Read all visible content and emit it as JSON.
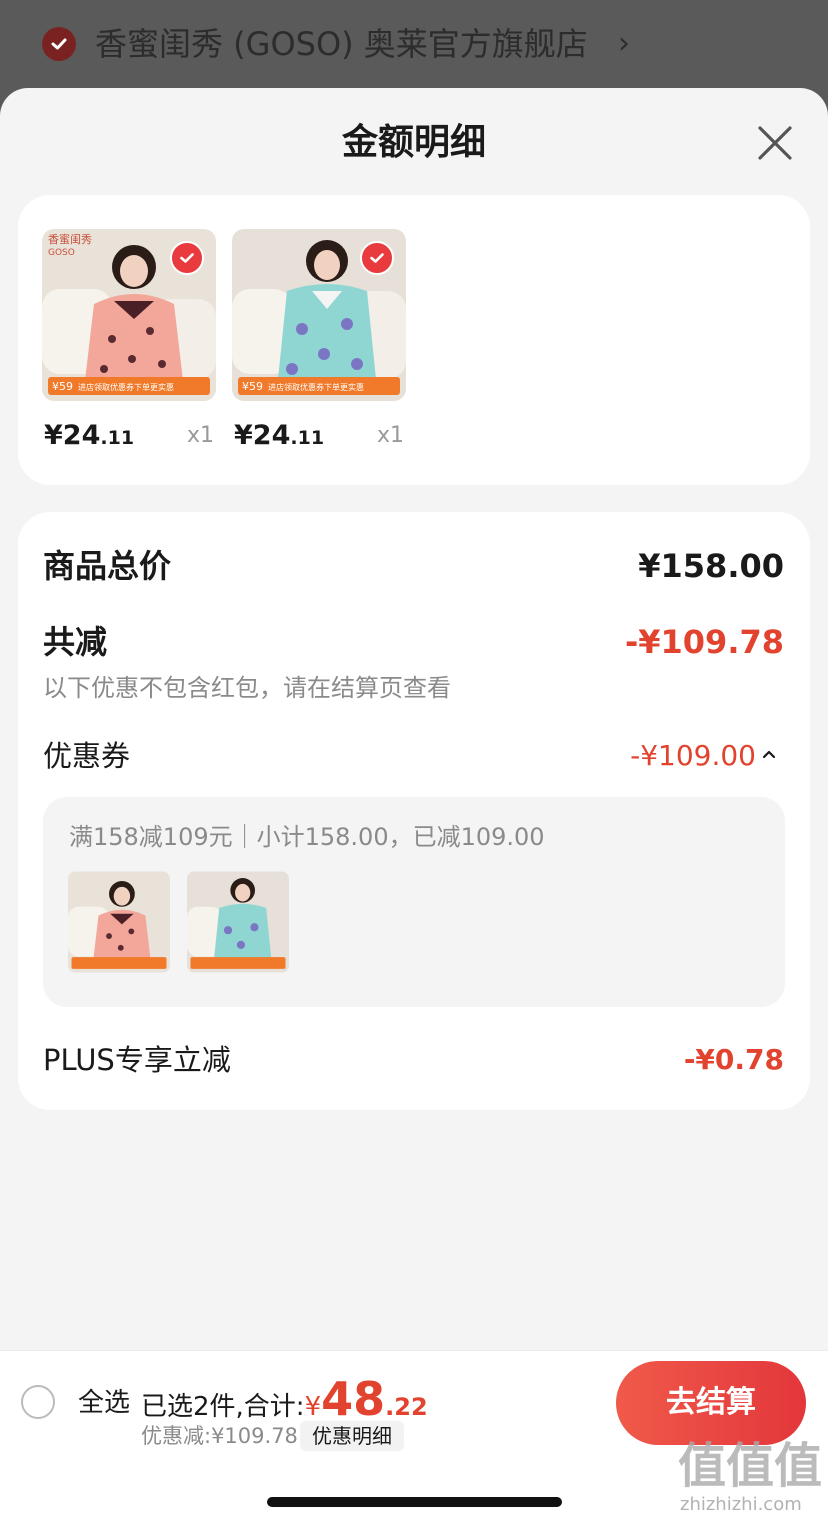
{
  "shop": {
    "name": "香蜜闺秀 (GOSO) 奥莱官方旗舰店",
    "chevron": "›",
    "check_icon": "check-circle-icon"
  },
  "sheet": {
    "title": "金额明细",
    "close_icon": "close-icon"
  },
  "products": [
    {
      "price_main": "¥24",
      "price_cents": ".11",
      "qty": "x1",
      "badge_price": "¥59",
      "badge_text": "进店领取优惠券下单更实惠",
      "brand": "香蜜闺秀",
      "brand_sub": "GOSO",
      "color": "pink"
    },
    {
      "price_main": "¥24",
      "price_cents": ".11",
      "qty": "x1",
      "badge_price": "¥59",
      "badge_text": "进店领取优惠券下单更实惠",
      "color": "aqua"
    }
  ],
  "detail": {
    "total_label": "商品总价",
    "total_value": "¥158.00",
    "reduce_label": "共减",
    "reduce_value": "-¥109.78",
    "note": "以下优惠不包含红包，请在结算页查看",
    "coupon_label": "优惠券",
    "coupon_value": "-¥109.00",
    "coupon_toggle_icon": "chevron-up-icon",
    "coupon_desc": "满158减109元｜小计158.00，已减109.00",
    "plus_label": "PLUS专享立减",
    "plus_value": "-¥0.78"
  },
  "bottom": {
    "select_all": "全选",
    "selected_text": "已选2件,合计:",
    "total_yen": "¥",
    "total_main": "48",
    "total_cents": ".22",
    "discount_text": "优惠减:¥109.78",
    "detail_chip": "优惠明细",
    "checkout": "去结算"
  },
  "watermark": {
    "glyphs": "值值值",
    "url": "zhizhizhi.com"
  },
  "colors": {
    "accent_red": "#e2432f",
    "check_red": "#e93b3d",
    "overlay": "#5a5a5a"
  }
}
